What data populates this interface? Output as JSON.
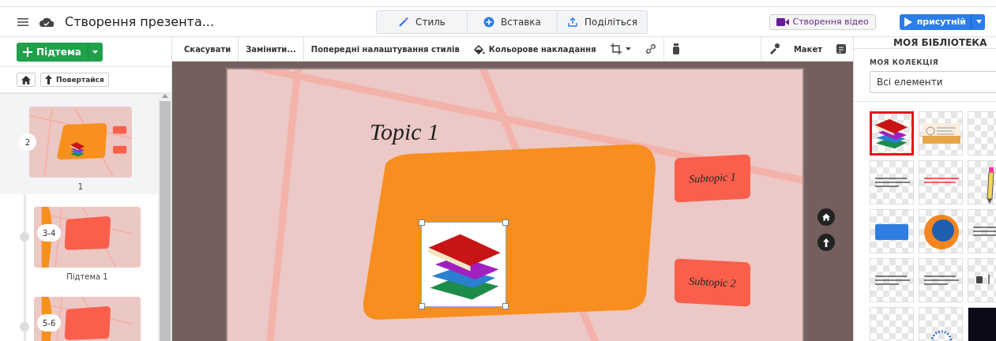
{
  "header": {
    "title": "Створення презента...",
    "tabs": [
      {
        "label": "Стиль",
        "kind": "style",
        "selected": false
      },
      {
        "label": "Вставка",
        "kind": "insert",
        "selected": false
      },
      {
        "label": "Поділіться",
        "kind": "share",
        "selected": false
      }
    ],
    "video_button": "Створення відео",
    "present_button": "присутній"
  },
  "sidebar": {
    "add_button": "Підтема",
    "back_button": "Повертайся",
    "slides": [
      {
        "badge": "2",
        "label": "1",
        "kind": "topic",
        "selected": true
      },
      {
        "badge": "3-4",
        "label": "Підтема 1",
        "kind": "subtopic",
        "selected": false
      },
      {
        "badge": "5-6",
        "kind": "subtopic",
        "selected": false
      }
    ]
  },
  "toolbar": {
    "items": [
      {
        "label": "Скасувати",
        "kind": "text"
      },
      {
        "label": "Замінити...",
        "kind": "text"
      },
      {
        "label": "Попередні налаштування стилів",
        "kind": "text"
      },
      {
        "label": "Кольорове накладання",
        "kind": "fill"
      },
      {
        "kind": "crop"
      },
      {
        "kind": "link"
      },
      {
        "kind": "ink"
      },
      {
        "kind": "spacer"
      },
      {
        "kind": "brush"
      },
      {
        "label": "Макет",
        "kind": "text"
      },
      {
        "kind": "notes"
      }
    ]
  },
  "slide": {
    "title": "Topic 1",
    "subtopics": [
      "Subtopic 1",
      "Subtopic 2"
    ]
  },
  "library": {
    "heading": "МОЯ БІБЛІОТЕКА",
    "collection_label": "МОЯ КОЛЕКЦІЯ",
    "filter": "Всі елементи",
    "items": [
      {
        "kind": "books",
        "selected": true
      },
      {
        "kind": "banner",
        "selected": false
      },
      {
        "kind": "empty",
        "selected": false
      },
      {
        "kind": "text",
        "selected": false
      },
      {
        "kind": "redtext",
        "selected": false
      },
      {
        "kind": "pencil",
        "selected": false
      },
      {
        "kind": "button",
        "selected": false
      },
      {
        "kind": "globe",
        "selected": false
      },
      {
        "kind": "text",
        "selected": false
      },
      {
        "kind": "text",
        "selected": false
      },
      {
        "kind": "text",
        "selected": false
      },
      {
        "kind": "lock",
        "selected": false
      },
      {
        "kind": "empty",
        "selected": false
      },
      {
        "kind": "seal",
        "selected": false
      },
      {
        "kind": "dark",
        "selected": false
      }
    ]
  }
}
